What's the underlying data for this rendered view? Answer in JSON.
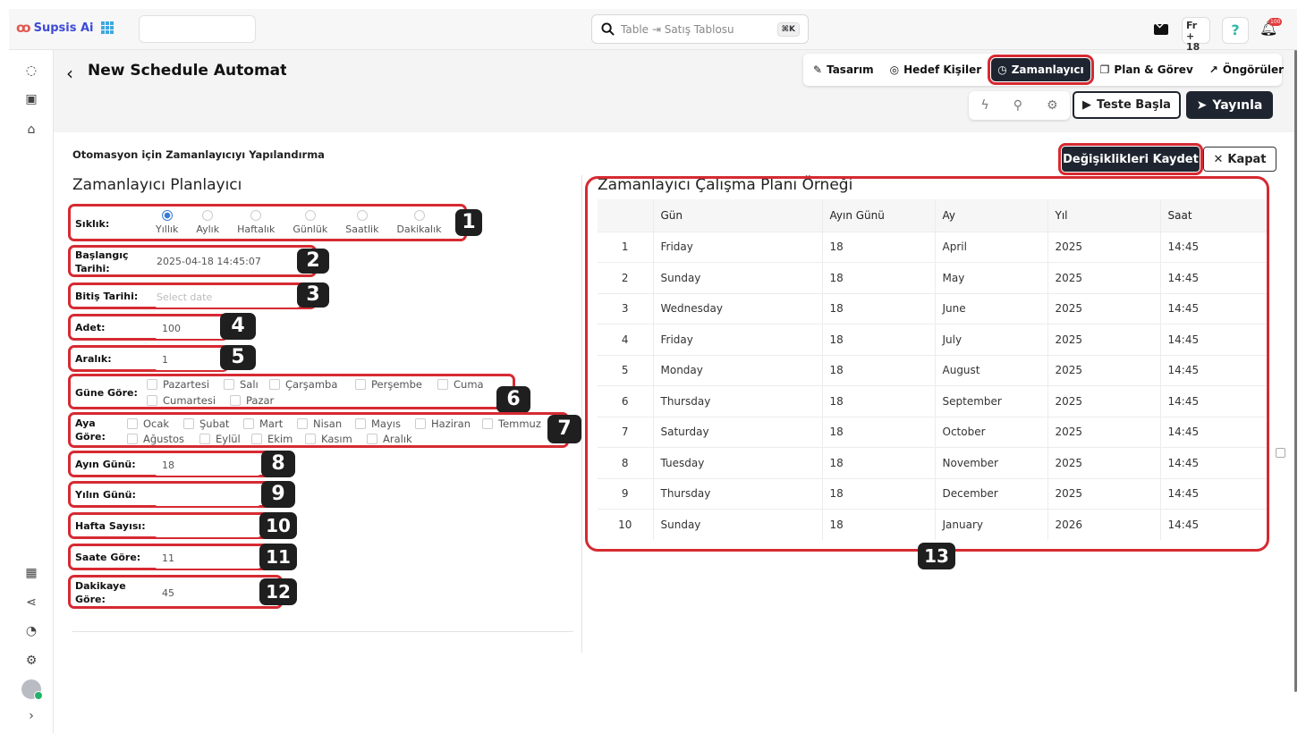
{
  "app": {
    "brand": "Supsis Ai"
  },
  "search": {
    "placeholder": "Table ⇥ Satış Tablosu",
    "shortcut": "⌘K"
  },
  "top_right": {
    "lang_label": "Fr",
    "date_num": "18",
    "notification_count": "100"
  },
  "page": {
    "title": "New Schedule Automation",
    "subtitle": "Otomasyon için Zamanlayıcıyı Yapılandırma"
  },
  "tabs": [
    {
      "label": "Tasarım",
      "icon": "magic-wand-icon"
    },
    {
      "label": "Hedef Kişiler",
      "icon": "target-icon"
    },
    {
      "label": "Zamanlayıcı",
      "icon": "clock-icon",
      "active": true
    },
    {
      "label": "Plan & Görev",
      "icon": "layers-icon"
    },
    {
      "label": "Öngörüler",
      "icon": "trend-icon"
    }
  ],
  "actions": {
    "test": "Teste Başla",
    "publish": "Yayınla",
    "save": "Değişiklikleri Kaydet",
    "close": "Kapat"
  },
  "form": {
    "heading": "Zamanlayıcı Planlayıcı",
    "frequency": {
      "label": "Sıklık:",
      "options": [
        "Yıllık",
        "Aylık",
        "Haftalık",
        "Günlük",
        "Saatlik",
        "Dakikalık"
      ],
      "selected": "Yıllık"
    },
    "start_date": {
      "label": "Başlangıç Tarihi:",
      "label_line1": "Başlangıç",
      "label_line2": "Tarihi:",
      "value": "2025-04-18 14:45:07"
    },
    "end_date": {
      "label": "Bitiş Tarihi:",
      "placeholder": "Select date"
    },
    "count": {
      "label": "Adet:",
      "value": "100"
    },
    "interval": {
      "label": "Aralık:",
      "value": "1"
    },
    "by_weekday": {
      "label": "Güne Göre:",
      "options": [
        "Pazartesi",
        "Salı",
        "Çarşamba",
        "Perşembe",
        "Cuma",
        "Cumartesi",
        "Pazar"
      ]
    },
    "by_month": {
      "label_line1": "Aya",
      "label_line2": "Göre:",
      "options": [
        "Ocak",
        "Şubat",
        "Mart",
        "Nisan",
        "Mayıs",
        "Haziran",
        "Temmuz",
        "Ağustos",
        "Eylül",
        "Ekim",
        "Kasım",
        "Aralık"
      ]
    },
    "month_day": {
      "label": "Ayın Günü:",
      "value": "18"
    },
    "year_day": {
      "label": "Yılın Günü:",
      "value": ""
    },
    "week_number": {
      "label": "Hafta Sayısı:",
      "value": ""
    },
    "by_hour": {
      "label": "Saate Göre:",
      "value": "11"
    },
    "by_minute": {
      "label_line1": "Dakikaye",
      "label_line2": "Göre:",
      "value": "45"
    }
  },
  "markers": [
    "1",
    "2",
    "3",
    "4",
    "5",
    "6",
    "7",
    "8",
    "9",
    "10",
    "11",
    "12",
    "13"
  ],
  "preview": {
    "heading": "Zamanlayıcı Çalışma Planı Örneği",
    "columns": [
      "",
      "Gün",
      "Ayın Günü",
      "Ay",
      "Yıl",
      "Saat"
    ],
    "rows": [
      [
        "1",
        "Friday",
        "18",
        "April",
        "2025",
        "14:45"
      ],
      [
        "2",
        "Sunday",
        "18",
        "May",
        "2025",
        "14:45"
      ],
      [
        "3",
        "Wednesday",
        "18",
        "June",
        "2025",
        "14:45"
      ],
      [
        "4",
        "Friday",
        "18",
        "July",
        "2025",
        "14:45"
      ],
      [
        "5",
        "Monday",
        "18",
        "August",
        "2025",
        "14:45"
      ],
      [
        "6",
        "Thursday",
        "18",
        "September",
        "2025",
        "14:45"
      ],
      [
        "7",
        "Saturday",
        "18",
        "October",
        "2025",
        "14:45"
      ],
      [
        "8",
        "Tuesday",
        "18",
        "November",
        "2025",
        "14:45"
      ],
      [
        "9",
        "Thursday",
        "18",
        "December",
        "2025",
        "14:45"
      ],
      [
        "10",
        "Sunday",
        "18",
        "January",
        "2026",
        "14:45"
      ]
    ]
  },
  "colors": {
    "accent": "#1f2530",
    "highlight": "#d62a32",
    "radio": "#3a7bd5"
  }
}
